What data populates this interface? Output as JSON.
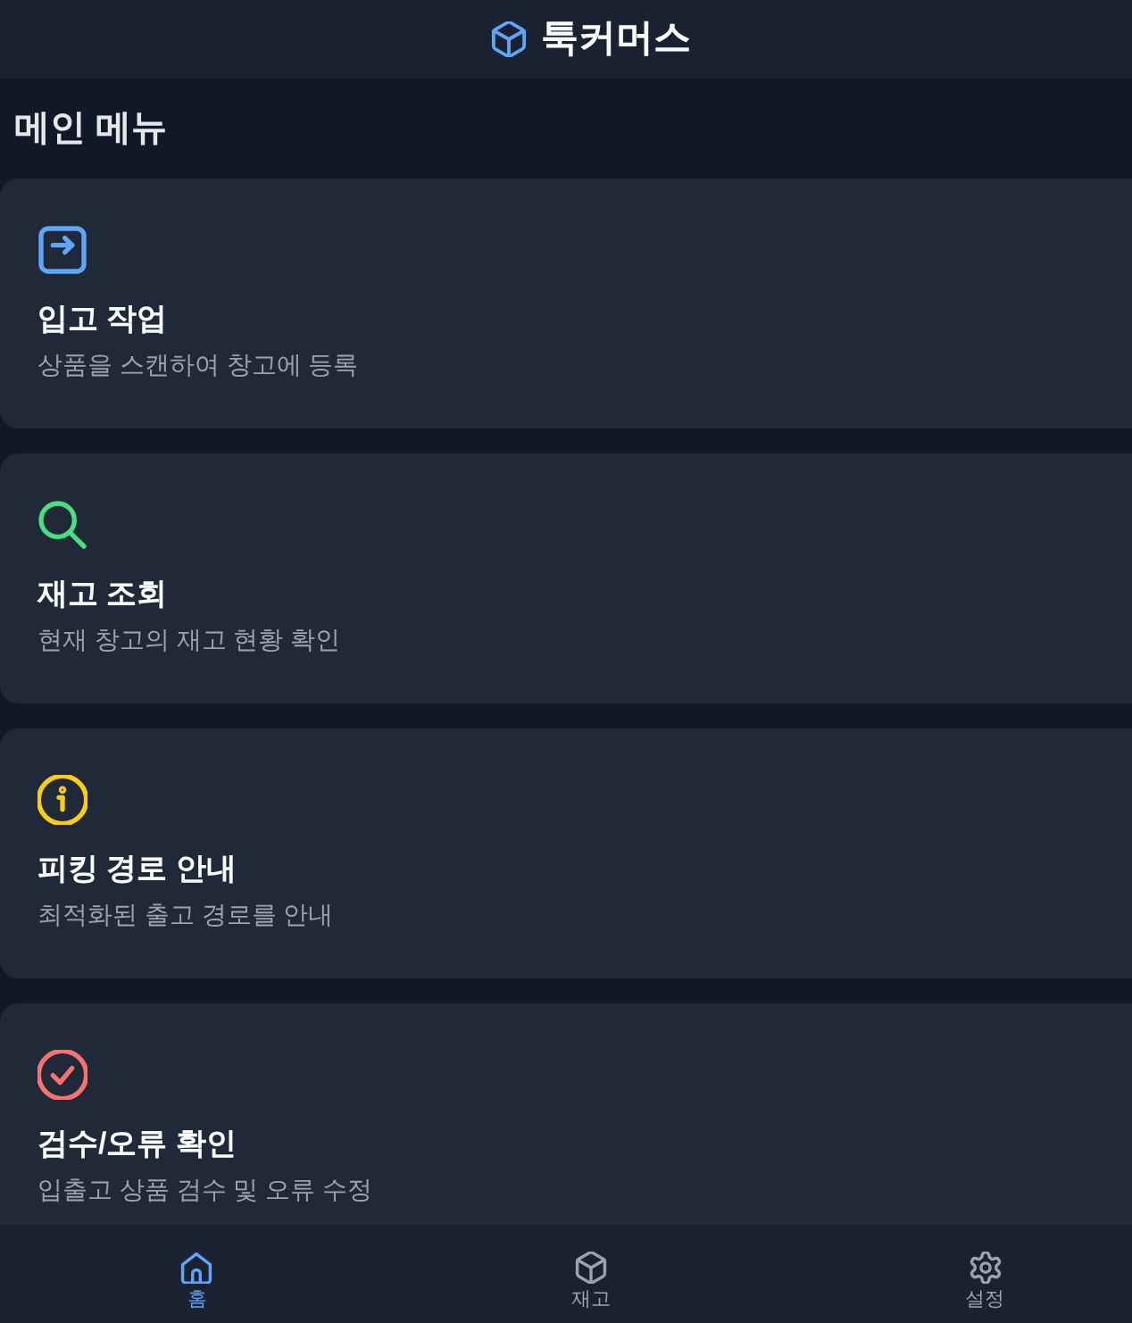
{
  "header": {
    "title": "툭커머스"
  },
  "section": {
    "title": "메인 메뉴"
  },
  "menu": [
    {
      "title": "입고 작업",
      "description": "상품을 스캔하여 창고에 등록",
      "color": "#60a5fa"
    },
    {
      "title": "재고 조회",
      "description": "현재 창고의 재고 현황 확인",
      "color": "#4ade80"
    },
    {
      "title": "피킹 경로 안내",
      "description": "최적화된 출고 경로를 안내",
      "color": "#facc15"
    },
    {
      "title": "검수/오류 확인",
      "description": "입출고 상품 검수 및 오류 수정",
      "color": "#f87171"
    }
  ],
  "nav": [
    {
      "label": "홈",
      "selected": true
    },
    {
      "label": "재고",
      "selected": false
    },
    {
      "label": "설정",
      "selected": false
    }
  ]
}
